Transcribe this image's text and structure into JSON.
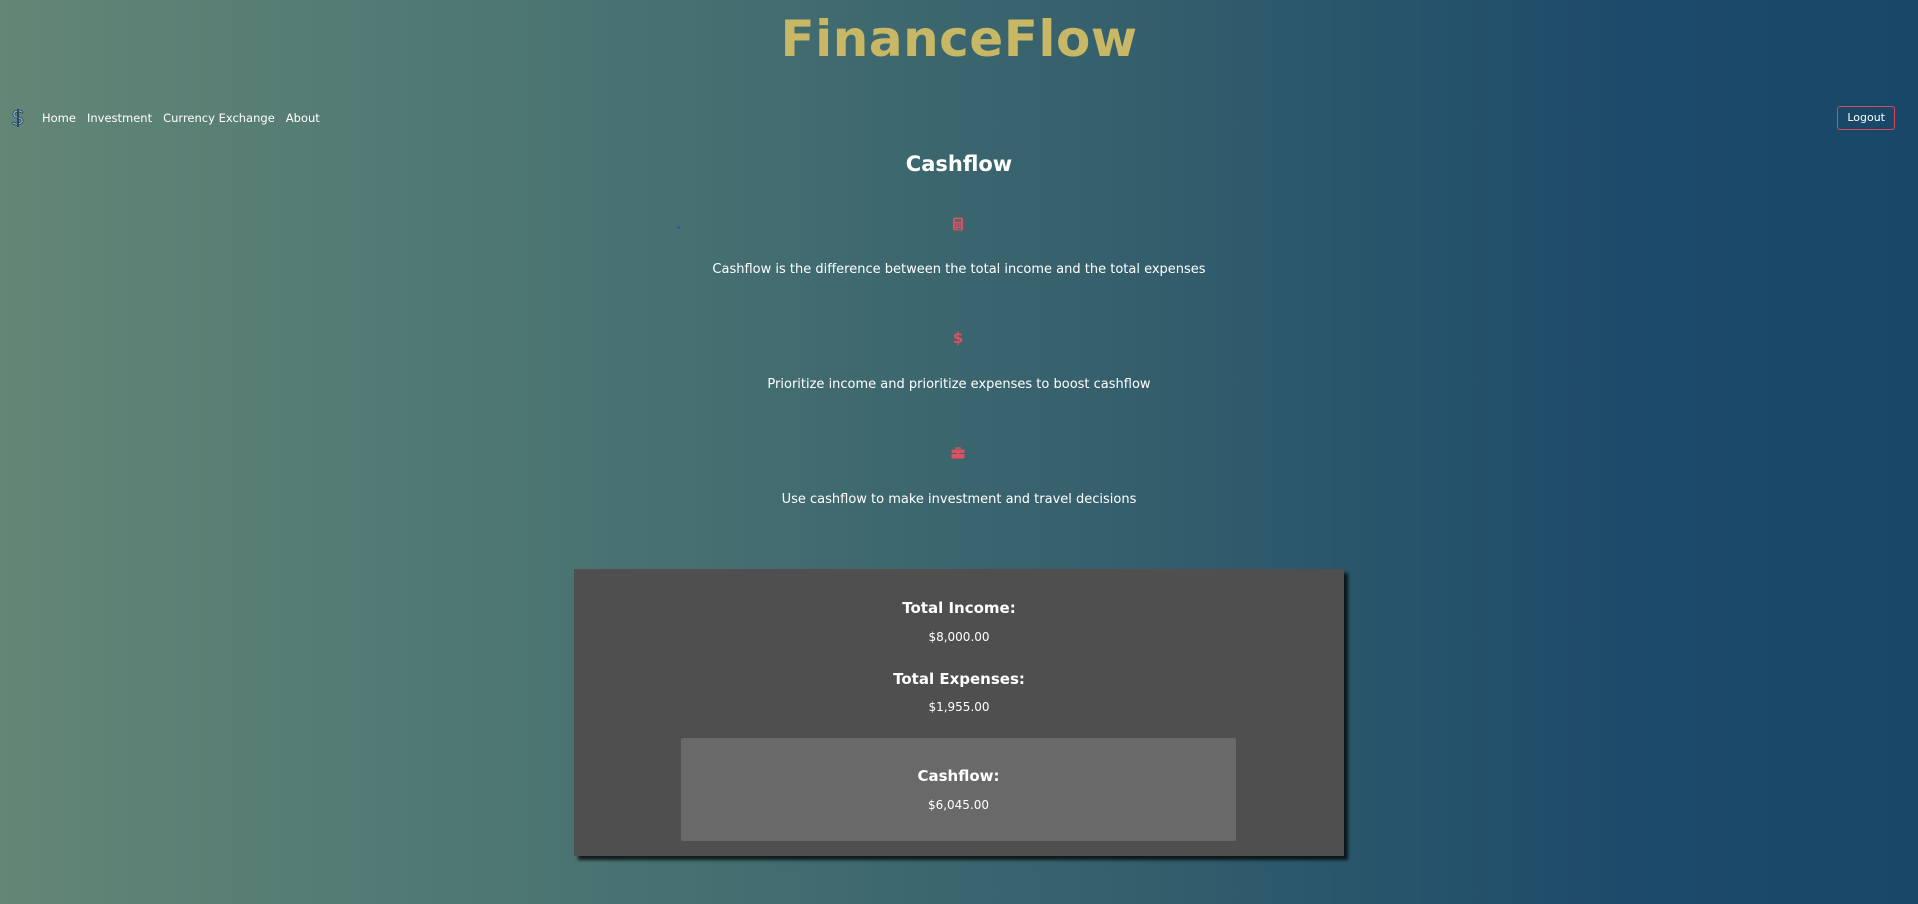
{
  "brand": {
    "title": "FinanceFlow",
    "color": "#c8b865"
  },
  "nav": {
    "logo_icon": "dollar-logo-icon",
    "links": [
      "Home",
      "Investment",
      "Currency Exchange",
      "About"
    ],
    "logout_label": "Logout",
    "logout_border_color": "#e0455a"
  },
  "page": {
    "title": "Cashflow"
  },
  "features": [
    {
      "icon": "calculator-icon",
      "text": "Cashflow is the difference between the total income and the total expenses"
    },
    {
      "icon": "dollar-icon",
      "text": "Prioritize income and prioritize expenses to boost cashflow"
    },
    {
      "icon": "briefcase-icon",
      "text": "Use cashflow to make investment and travel decisions"
    }
  ],
  "accent_color": "#e05060",
  "summary": {
    "income_label": "Total Income:",
    "income_value": "$8,000.00",
    "expenses_label": "Total Expenses:",
    "expenses_value": "$1,955.00",
    "cashflow_label": "Cashflow:",
    "cashflow_value": "$6,045.00"
  }
}
